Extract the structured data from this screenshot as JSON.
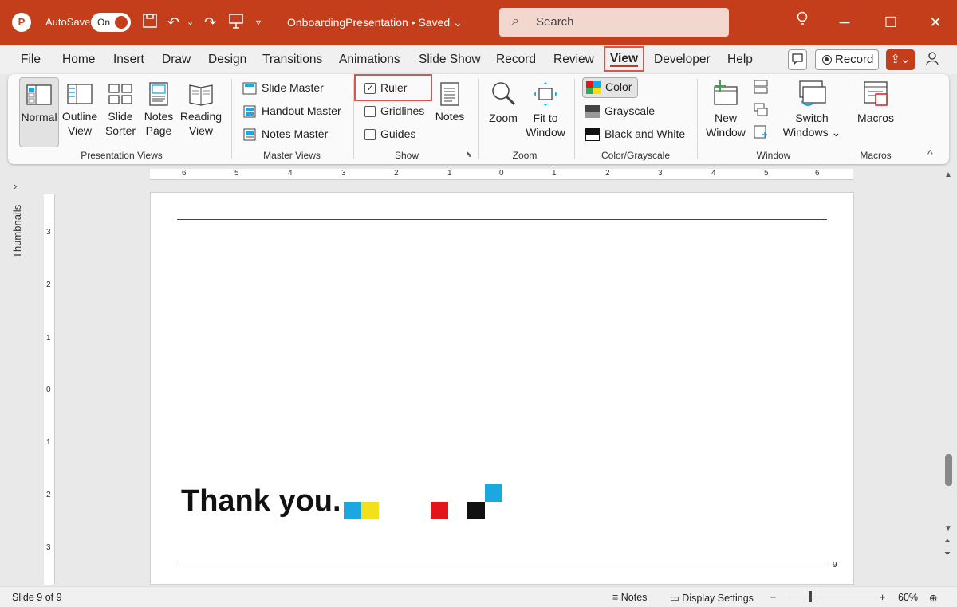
{
  "titlebar": {
    "autosave_label": "AutoSave",
    "autosave_state": "On",
    "doc_title": "OnboardingPresentation • Saved ⌄",
    "search_placeholder": "Search",
    "accent": "#c43e1c"
  },
  "tabs": [
    "File",
    "Home",
    "Insert",
    "Draw",
    "Design",
    "Transitions",
    "Animations",
    "Slide Show",
    "Record",
    "Review",
    "View",
    "Developer",
    "Help"
  ],
  "active_tab": "View",
  "record_label": "Record",
  "ribbon": {
    "presentation_views": {
      "label": "Presentation Views",
      "normal": "Normal",
      "outline_view": [
        "Outline",
        "View"
      ],
      "slide_sorter": [
        "Slide",
        "Sorter"
      ],
      "notes_page": [
        "Notes",
        "Page"
      ],
      "reading_view": [
        "Reading",
        "View"
      ]
    },
    "master_views": {
      "label": "Master Views",
      "slide_master": "Slide Master",
      "handout_master": "Handout Master",
      "notes_master": "Notes Master"
    },
    "show": {
      "label": "Show",
      "ruler": "Ruler",
      "gridlines": "Gridlines",
      "guides": "Guides",
      "notes": "Notes"
    },
    "zoom": {
      "label": "Zoom",
      "zoom": "Zoom",
      "fit_to_window": [
        "Fit to",
        "Window"
      ]
    },
    "color_grayscale": {
      "label": "Color/Grayscale",
      "color": "Color",
      "grayscale": "Grayscale",
      "black_and_white": "Black and White"
    },
    "window": {
      "label": "Window",
      "new_window": [
        "New",
        "Window"
      ],
      "switch_windows": [
        "Switch",
        "Windows ⌄"
      ]
    },
    "macros": {
      "label": "Macros",
      "macros": "Macros"
    }
  },
  "thumbnails_label": "Thumbnails",
  "hruler_numbers": [
    "6",
    "5",
    "4",
    "3",
    "2",
    "1",
    "0",
    "1",
    "2",
    "3",
    "4",
    "5",
    "6"
  ],
  "vruler_numbers": [
    "3",
    "2",
    "1",
    "0",
    "1",
    "2",
    "3"
  ],
  "slide": {
    "text": "Thank you.",
    "page_number": "9",
    "colors": {
      "cyan": "#1ba8e0",
      "yellow": "#f1e01a",
      "red": "#e3151a",
      "black": "#111111"
    }
  },
  "statusbar": {
    "slide_info": "Slide 9 of 9",
    "notes": "Notes",
    "display_settings": "Display Settings",
    "zoom_level": "60%"
  }
}
